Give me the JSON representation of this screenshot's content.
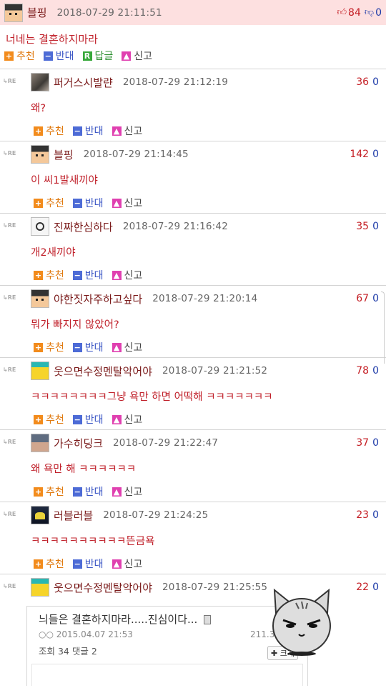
{
  "post": {
    "nick": "블핑",
    "date": "2018-07-29 21:11:51",
    "up": "84",
    "down": "0",
    "title": "너네는 결혼하지마라",
    "actions": {
      "up": "추천",
      "down": "반대",
      "reply": "답글",
      "report": "신고"
    }
  },
  "labels": {
    "up": "추천",
    "down": "반대",
    "report": "신고",
    "re": "RE",
    "reply_box": "R"
  },
  "comments": [
    {
      "nick": "퍼거스시발랸",
      "date": "2018-07-29 21:12:19",
      "up": "36",
      "down": "0",
      "text": "왜?"
    },
    {
      "nick": "블핑",
      "date": "2018-07-29 21:14:45",
      "up": "142",
      "down": "0",
      "text": "이 씨1발새끼야"
    },
    {
      "nick": "진짜한심하다",
      "date": "2018-07-29 21:16:42",
      "up": "35",
      "down": "0",
      "text": "개2새끼야"
    },
    {
      "nick": "야한짓자주하고싶다",
      "date": "2018-07-29 21:20:14",
      "up": "67",
      "down": "0",
      "text": "뭐가 빠지지 않았어?"
    },
    {
      "nick": "웃으면수정멘탈악어야",
      "date": "2018-07-29 21:21:52",
      "up": "78",
      "down": "0",
      "text": "ㅋㅋㅋㅋㅋㅋㅋㅋ그냥 욕만 하면 어떡해 ㅋㅋㅋㅋㅋㅋㅋ"
    },
    {
      "nick": "가수히딩크",
      "date": "2018-07-29 21:22:47",
      "up": "37",
      "down": "0",
      "text": "왜 욕만 해 ㅋㅋㅋㅋㅋㅋ"
    },
    {
      "nick": "러블러블",
      "date": "2018-07-29 21:24:25",
      "up": "23",
      "down": "0",
      "text": "ㅋㅋㅋㅋㅋㅋㅋㅋㅋㅋ뜬금욕"
    },
    {
      "nick": "웃으면수정멘탈악어야",
      "date": "2018-07-29 21:25:55",
      "up": "22",
      "down": "0",
      "text": ""
    }
  ],
  "card": {
    "title": "늬들은 결혼하지마라.....진심이다...",
    "meta": "○○ 2015.04.07 21:53",
    "ip": "211.3",
    "stats": "조회 34 댓글 2",
    "button": "크게"
  },
  "icons": {
    "thumb_up": "thumb-up-icon",
    "thumb_down": "thumb-down-icon",
    "plus": "plus-icon",
    "minus": "minus-icon",
    "report": "report-icon",
    "reply_arrow": "reply-arrow-icon",
    "attachment": "attachment-icon",
    "mascot": "cat-mascot-icon"
  },
  "colors": {
    "header_bg": "#fde0e0",
    "title_red": "#c0202a",
    "nick": "#7a1a1a",
    "up_orange": "#f28b1c",
    "down_blue": "#4d6bd6"
  }
}
